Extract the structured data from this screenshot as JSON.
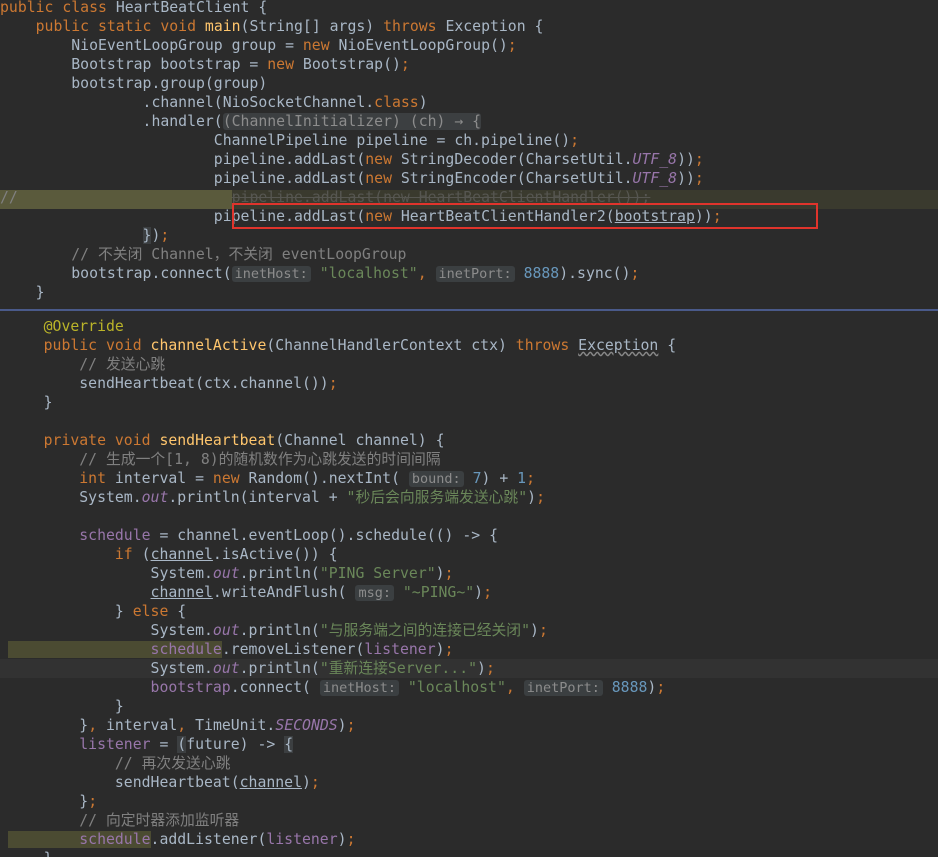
{
  "top_pane": {
    "lines": [
      [
        [
          "kw",
          "public class "
        ],
        [
          "p",
          "HeartBeatClient {"
        ]
      ],
      [
        [
          "kw",
          "    public static void "
        ],
        [
          "fn",
          "main"
        ],
        [
          "p",
          "(String[] args) "
        ],
        [
          "kw",
          "throws "
        ],
        [
          "p",
          "Exception {"
        ]
      ],
      [
        [
          "p",
          "        NioEventLoopGroup group = "
        ],
        [
          "kw",
          "new "
        ],
        [
          "p",
          "NioEventLoopGroup()"
        ],
        [
          "kw",
          ";"
        ]
      ],
      [
        [
          "p",
          "        Bootstrap bootstrap = "
        ],
        [
          "kw",
          "new "
        ],
        [
          "p",
          "Bootstrap()"
        ],
        [
          "kw",
          ";"
        ]
      ],
      [
        [
          "p",
          "        bootstrap.group(group)"
        ]
      ],
      [
        [
          "p",
          "                .channel(NioSocketChannel."
        ],
        [
          "kw",
          "class"
        ],
        [
          "p",
          ")"
        ]
      ],
      [
        [
          "p",
          "                .handler("
        ],
        [
          "fold",
          "(ChannelInitializer) (ch) → {"
        ]
      ],
      [
        [
          "p",
          "                        ChannelPipeline pipeline = ch.pipeline()"
        ],
        [
          "kw",
          ";"
        ]
      ],
      [
        [
          "p",
          "                        pipeline.addLast("
        ],
        [
          "kw",
          "new "
        ],
        [
          "p",
          "StringDecoder(CharsetUtil."
        ],
        [
          "cst",
          "UTF_8"
        ],
        [
          "p",
          "))"
        ],
        [
          "kw",
          ";"
        ]
      ],
      [
        [
          "p",
          "                        pipeline.addLast("
        ],
        [
          "kw",
          "new "
        ],
        [
          "p",
          "StringEncoder(CharsetUtil."
        ],
        [
          "cst",
          "UTF_8"
        ],
        [
          "p",
          "))"
        ],
        [
          "kw",
          ";"
        ]
      ],
      [
        [
          "com",
          "//"
        ],
        [
          "com",
          "                        "
        ],
        [
          "strike",
          "pipeline.addLast(new HeartBeatClientHandler());"
        ]
      ],
      [
        [
          "p",
          "                        pipeline.addLast("
        ],
        [
          "kw",
          "new "
        ],
        [
          "p",
          "HeartBeatClientHandler2("
        ],
        [
          "ul",
          "bootstrap"
        ],
        [
          "p",
          "))"
        ],
        [
          "kw",
          ";"
        ]
      ],
      [
        [
          "p",
          "                "
        ],
        [
          "bgplain",
          "}"
        ],
        [
          "p",
          ")"
        ],
        [
          "kw",
          ";"
        ]
      ],
      [
        [
          "com",
          "        // 不关闭 Channel，不关闭 eventLoopGroup"
        ]
      ],
      [
        [
          "p",
          "        bootstrap.connect("
        ],
        [
          "hint",
          "inetHost:"
        ],
        [
          "str",
          " \"localhost\""
        ],
        [
          "kw",
          ", "
        ],
        [
          "hint",
          "inetPort:"
        ],
        [
          "num",
          " 8888"
        ],
        [
          "p",
          ").sync()"
        ],
        [
          "kw",
          ";"
        ]
      ],
      [
        [
          "p",
          "    }"
        ]
      ]
    ]
  },
  "bottom_pane": {
    "lines": [
      [
        [
          "ann",
          "    @Override"
        ]
      ],
      [
        [
          "kw",
          "    public void "
        ],
        [
          "fn",
          "channelActive"
        ],
        [
          "p",
          "(ChannelHandlerContext ctx) "
        ],
        [
          "kw",
          "throws "
        ],
        [
          "wav",
          "Exception"
        ],
        [
          "p",
          " {"
        ]
      ],
      [
        [
          "com",
          "        // 发送心跳"
        ]
      ],
      [
        [
          "p",
          "        sendHeartbeat(ctx.channel())"
        ],
        [
          "kw",
          ";"
        ]
      ],
      [
        [
          "p",
          "    }"
        ]
      ],
      [
        [
          "p",
          ""
        ]
      ],
      [
        [
          "kw",
          "    private void "
        ],
        [
          "fn",
          "sendHeartbeat"
        ],
        [
          "p",
          "(Channel channel) {"
        ]
      ],
      [
        [
          "com",
          "        // 生成一个[1, 8)的随机数作为心跳发送的时间间隔"
        ]
      ],
      [
        [
          "kw",
          "        int "
        ],
        [
          "p",
          "interval = "
        ],
        [
          "kw",
          "new "
        ],
        [
          "p",
          "Random().nextInt( "
        ],
        [
          "hint",
          "bound:"
        ],
        [
          "num",
          " 7"
        ],
        [
          "p",
          ") + "
        ],
        [
          "num",
          "1"
        ],
        [
          "kw",
          ";"
        ]
      ],
      [
        [
          "p",
          "        System."
        ],
        [
          "cst",
          "out"
        ],
        [
          "p",
          ".println(interval + "
        ],
        [
          "str",
          "\"秒后会向服务端发送心跳\""
        ],
        [
          "p",
          ")"
        ],
        [
          "kw",
          ";"
        ]
      ],
      [
        [
          "p",
          ""
        ]
      ],
      [
        [
          "fld",
          "        schedule"
        ],
        [
          "p",
          " = channel.eventLoop().schedule(() -> {"
        ]
      ],
      [
        [
          "kw",
          "            if "
        ],
        [
          "p",
          "("
        ],
        [
          "ul",
          "channel"
        ],
        [
          "p",
          ".isActive()) {"
        ]
      ],
      [
        [
          "p",
          "                System."
        ],
        [
          "cst",
          "out"
        ],
        [
          "p",
          ".println("
        ],
        [
          "str",
          "\"PING Server\""
        ],
        [
          "p",
          ")"
        ],
        [
          "kw",
          ";"
        ]
      ],
      [
        [
          "p",
          "                "
        ],
        [
          "ul",
          "channel"
        ],
        [
          "p",
          ".writeAndFlush( "
        ],
        [
          "hint",
          "msg:"
        ],
        [
          "str",
          " \"~PING~\""
        ],
        [
          "p",
          ")"
        ],
        [
          "kw",
          ";"
        ]
      ],
      [
        [
          "p",
          "            } "
        ],
        [
          "kw",
          "else "
        ],
        [
          "p",
          "{"
        ]
      ],
      [
        [
          "p",
          "                System."
        ],
        [
          "cst",
          "out"
        ],
        [
          "p",
          ".println("
        ],
        [
          "str",
          "\"与服务端之间的连接已经关闭\""
        ],
        [
          "p",
          ")"
        ],
        [
          "kw",
          ";"
        ]
      ],
      [
        [
          "hlfld",
          "                schedule"
        ],
        [
          "p",
          ".removeListener("
        ],
        [
          "fld",
          "listener"
        ],
        [
          "p",
          ")"
        ],
        [
          "kw",
          ";"
        ]
      ],
      [
        [
          "p",
          "                System."
        ],
        [
          "cst",
          "out"
        ],
        [
          "p",
          ".println("
        ],
        [
          "str",
          "\"重新连接Server...\""
        ],
        [
          "p",
          ")"
        ],
        [
          "kw",
          ";"
        ]
      ],
      [
        [
          "fld",
          "                bootstrap"
        ],
        [
          "p",
          ".connect( "
        ],
        [
          "hint",
          "inetHost:"
        ],
        [
          "str",
          " \"localhost\""
        ],
        [
          "kw",
          ", "
        ],
        [
          "hint",
          "inetPort:"
        ],
        [
          "num",
          " 8888"
        ],
        [
          "p",
          ")"
        ],
        [
          "kw",
          ";"
        ]
      ],
      [
        [
          "p",
          "            }"
        ]
      ],
      [
        [
          "p",
          "        }"
        ],
        [
          "kw",
          ", "
        ],
        [
          "p",
          "interval"
        ],
        [
          "kw",
          ", "
        ],
        [
          "p",
          "TimeUnit."
        ],
        [
          "cst",
          "SECONDS"
        ],
        [
          "p",
          ")"
        ],
        [
          "kw",
          ";"
        ]
      ],
      [
        [
          "fld",
          "        listener"
        ],
        [
          "p",
          " = "
        ],
        [
          "bgplain",
          "("
        ],
        [
          "p",
          "future) -> "
        ],
        [
          "bgplain",
          "{"
        ]
      ],
      [
        [
          "com",
          "            // 再次发送心跳"
        ]
      ],
      [
        [
          "p",
          "            sendHeartbeat("
        ],
        [
          "ul",
          "channel"
        ],
        [
          "p",
          ")"
        ],
        [
          "kw",
          ";"
        ]
      ],
      [
        [
          "p",
          "        }"
        ],
        [
          "kw",
          ";"
        ]
      ],
      [
        [
          "com",
          "        // 向定时器添加监听器"
        ]
      ],
      [
        [
          "hlfld",
          "        schedule"
        ],
        [
          "p",
          ".addListener("
        ],
        [
          "fld",
          "listener"
        ],
        [
          "p",
          ")"
        ],
        [
          "kw",
          ";"
        ]
      ],
      [
        [
          "p",
          "    }"
        ]
      ]
    ]
  },
  "colors": {
    "background": "#2b2b2b",
    "keyword": "#cc7832",
    "method": "#ffc66d",
    "string": "#6a8759",
    "number": "#6897bb",
    "comment": "#808080",
    "field": "#9876aa",
    "annotation": "#bbb529",
    "red_box": "#e0342c"
  }
}
